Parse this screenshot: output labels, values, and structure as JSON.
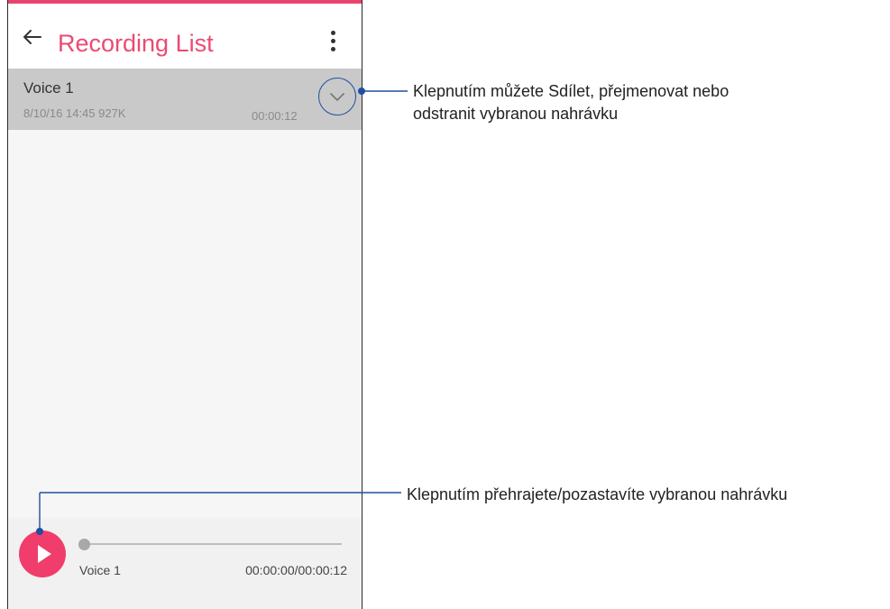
{
  "app": {
    "title": "Recording List"
  },
  "recordings": [
    {
      "name": "Voice 1",
      "meta": "8/10/16 14:45  927K",
      "duration": "00:00:12"
    }
  ],
  "player": {
    "track_name": "Voice 1",
    "time": "00:00:00/00:00:12",
    "progress": 0
  },
  "callouts": {
    "expand_line1": "Klepnutím můžete Sdílet, přejmenovat nebo",
    "expand_line2": "odstranit vybranou nahrávku",
    "play": "Klepnutím přehrajete/pozastavíte vybranou nahrávku"
  },
  "icons": {
    "back": "arrow-left-icon",
    "overflow": "more-vertical-icon",
    "expand": "chevron-down-icon",
    "play": "play-icon"
  },
  "colors": {
    "accent": "#ec4a73",
    "play_button": "#f03d6b",
    "selected_row": "#c9c9c9",
    "leader_line": "#1f4fa0"
  }
}
